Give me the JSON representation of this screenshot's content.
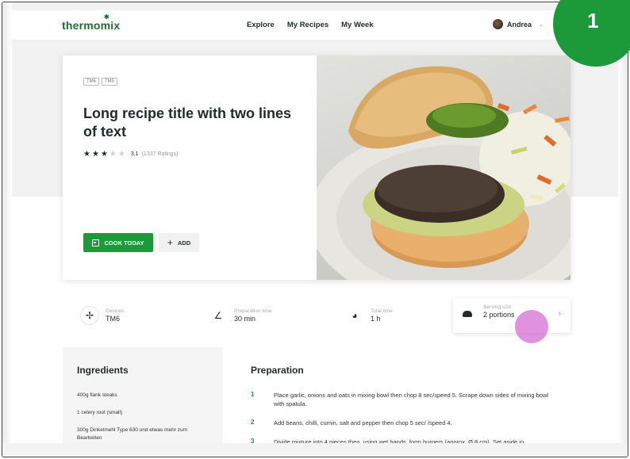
{
  "badge": {
    "number": "1",
    "color": "#1c9a3a"
  },
  "nav": {
    "logo": "thermomix",
    "links": [
      "Explore",
      "My Recipes",
      "My Week"
    ],
    "user_name": "Andrea"
  },
  "hero": {
    "tags": [
      "TM6",
      "TM5"
    ],
    "title": "Long recipe title with two lines of text",
    "rating": {
      "stars_filled": 3,
      "stars_total": 5,
      "value": "3.1",
      "count": "(1337 Ratings)"
    },
    "cook_today_label": "COOK TODAY",
    "add_label": "ADD",
    "image_alt": "burger with pesto and coleslaw"
  },
  "stats": [
    {
      "icon": "devices-icon",
      "label": "Devices",
      "value": "TM6"
    },
    {
      "icon": "knife-icon",
      "label": "Preparation time",
      "value": "30 min"
    },
    {
      "icon": "clock-icon",
      "label": "Total time",
      "value": "1 h"
    },
    {
      "icon": "serving-icon",
      "label": "Serving size",
      "value": "2 portions"
    }
  ],
  "ingredients": {
    "title": "Ingredients",
    "items": [
      "400g flank steaks",
      "1 celery root (small)",
      "300g Dinkelmehl Type 630 und etwas mehr zum Bearbeiten"
    ]
  },
  "preparation": {
    "title": "Preparation",
    "steps": [
      {
        "num": "1",
        "text": "Place garlic, onions and oats in mixing bowl then chop 8 sec/speed 5. Scrape down sides of mixing bowl with spatula."
      },
      {
        "num": "2",
        "text": "Add beans, chilli, cumin, salt and pepper then chop 5 sec/  /speed 4."
      },
      {
        "num": "3",
        "text": "Divide mixture into 4 pieces then, using wet hands, form burgers (approx. Ø 8 cm). Set aside in"
      }
    ]
  },
  "colors": {
    "brand_green": "#1c9a3a",
    "logo_green": "#1f6e33",
    "touch_indicator": "#d66ed6"
  }
}
